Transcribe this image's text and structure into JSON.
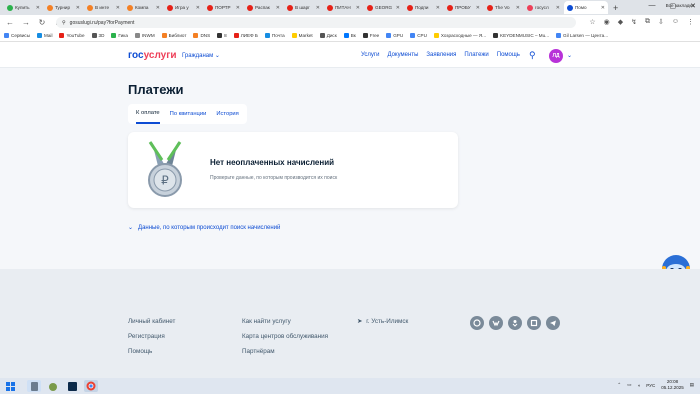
{
  "browser": {
    "tabs": [
      {
        "label": "Купить",
        "color": "#2bb24c"
      },
      {
        "label": "Турнир",
        "color": "#f48024"
      },
      {
        "label": "В инте",
        "color": "#f48024"
      },
      {
        "label": "Компа",
        "color": "#f48024"
      },
      {
        "label": "Игра у",
        "color": "#e62117"
      },
      {
        "label": "ПОРТР",
        "color": "#e62117"
      },
      {
        "label": "Распак",
        "color": "#e62117"
      },
      {
        "label": "В шарг",
        "color": "#e62117"
      },
      {
        "label": "ПИТАН",
        "color": "#e62117"
      },
      {
        "label": "GEORG",
        "color": "#e62117"
      },
      {
        "label": "Подпи",
        "color": "#e62117"
      },
      {
        "label": "ПРОБУ",
        "color": "#e62117"
      },
      {
        "label": "The Vo",
        "color": "#e62117"
      },
      {
        "label": "госусл",
        "color": "#ee3f58"
      },
      {
        "label": "Помо",
        "color": "#0d4cd3",
        "active": true
      }
    ],
    "url": "gosuslugi.ru/pay?forPayment",
    "bookmarks": [
      {
        "label": "Сервисы",
        "color": "#4285f4"
      },
      {
        "label": "Mail",
        "color": "#168de2"
      },
      {
        "label": "YouTube",
        "color": "#e62117"
      },
      {
        "label": "3D",
        "color": "#555555"
      },
      {
        "label": "Гика",
        "color": "#2bb24c"
      },
      {
        "label": "INWM",
        "color": "#888888"
      },
      {
        "label": "Библиот",
        "color": "#f48024"
      },
      {
        "label": "DNS",
        "color": "#f48024"
      },
      {
        "label": "8",
        "color": "#333333"
      },
      {
        "label": "ЛИЕФ Б",
        "color": "#e62117"
      },
      {
        "label": "Почта",
        "color": "#168de2"
      },
      {
        "label": "Market",
        "color": "#ffcc00"
      },
      {
        "label": "Диск",
        "color": "#555555"
      },
      {
        "label": "Вк",
        "color": "#0077ff"
      },
      {
        "label": "Free",
        "color": "#333333"
      },
      {
        "label": "GPU",
        "color": "#4285f4"
      },
      {
        "label": "CPU",
        "color": "#4285f4"
      },
      {
        "label": "Хозрасходные — Я...",
        "color": "#ffcc00"
      },
      {
        "label": "KEYDENMUSIC – Mu...",
        "color": "#333333"
      },
      {
        "label": "Gil Larsen — Цента...",
        "color": "#4285f4"
      }
    ],
    "all_bookmarks": "Все закладки"
  },
  "site": {
    "logo_main": "гос",
    "logo_accent": "услуги",
    "citizens": "Гражданам",
    "nav": [
      "Услуги",
      "Документы",
      "Заявления",
      "Платежи",
      "Помощь"
    ],
    "avatar_initials": "ЛД"
  },
  "payments": {
    "title": "Платежи",
    "tabs": [
      "К оплате",
      "По квитанции",
      "История"
    ],
    "empty_title": "Нет неоплаченных начислений",
    "empty_sub": "Проверьте данные, по которым производится их поиск",
    "search_data_link": "Данные, по которым происходит поиск начислений"
  },
  "footer": {
    "col1": [
      "Личный кабинет",
      "Регистрация",
      "Помощь"
    ],
    "col2": [
      "Как найти услугу",
      "Карта центров обслуживания",
      "Партнёрам"
    ],
    "city": "г. Усть-Илимск",
    "socials": [
      "ok-social",
      "vk-social",
      "odnoklassniki-social",
      "rutube-social",
      "telegram-social"
    ]
  },
  "taskbar": {
    "lang": "РУС",
    "time": "20:08",
    "date": "05.12.2025"
  }
}
